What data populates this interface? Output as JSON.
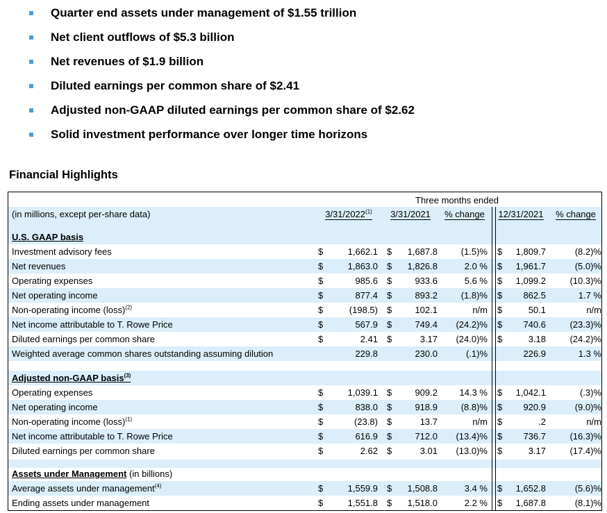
{
  "bullets": [
    "Quarter end assets under management of $1.55 trillion",
    "Net client outflows of $5.3 billion",
    "Net revenues of $1.9 billion",
    "Diluted earnings per common share of $2.41",
    "Adjusted non-GAAP diluted earnings per common share of $2.62",
    "Solid investment performance over longer time horizons"
  ],
  "heading": "Financial Highlights",
  "table": {
    "group_header": "Three months ended",
    "units_label": "(in millions, except per-share data)",
    "columns": {
      "c1": "3/31/2022",
      "c1_note": "(1)",
      "c2": "3/31/2021",
      "c3": "% change",
      "c4": "12/31/2021",
      "c5": "% change"
    },
    "sections": {
      "gaap": "U.S. GAAP basis",
      "nongaap": "Adjusted non-GAAP basis",
      "nongaap_note": "(3)",
      "aum": "Assets under Management",
      "aum_suffix": " (in billions)"
    },
    "dollar": "$",
    "rows": [
      {
        "label": "Investment advisory fees",
        "note": "",
        "d1": "$",
        "v1": "1,662.1",
        "d2": "$",
        "v2": "1,687.8",
        "p1": "(1.5)%",
        "d4": "$",
        "v4": "1,809.7",
        "p2": "(8.2)%"
      },
      {
        "label": "Net revenues",
        "note": "",
        "d1": "$",
        "v1": "1,863.0",
        "d2": "$",
        "v2": "1,826.8",
        "p1": "2.0 %",
        "d4": "$",
        "v4": "1,961.7",
        "p2": "(5.0)%"
      },
      {
        "label": "Operating expenses",
        "note": "",
        "d1": "$",
        "v1": "985.6",
        "d2": "$",
        "v2": "933.6",
        "p1": "5.6 %",
        "d4": "$",
        "v4": "1,099.2",
        "p2": "(10.3)%"
      },
      {
        "label": "Net operating income",
        "note": "",
        "d1": "$",
        "v1": "877.4",
        "d2": "$",
        "v2": "893.2",
        "p1": "(1.8)%",
        "d4": "$",
        "v4": "862.5",
        "p2": "1.7 %"
      },
      {
        "label": "Non-operating income (loss)",
        "note": "(2)",
        "d1": "$",
        "v1": "(198.5)",
        "d2": "$",
        "v2": "102.1",
        "p1": "n/m",
        "d4": "$",
        "v4": "50.1",
        "p2": "n/m"
      },
      {
        "label": "Net income attributable to T. Rowe Price",
        "note": "",
        "d1": "$",
        "v1": "567.9",
        "d2": "$",
        "v2": "749.4",
        "p1": "(24.2)%",
        "d4": "$",
        "v4": "740.6",
        "p2": "(23.3)%"
      },
      {
        "label": "Diluted earnings per common share",
        "note": "",
        "d1": "$",
        "v1": "2.41",
        "d2": "$",
        "v2": "3.17",
        "p1": "(24.0)%",
        "d4": "$",
        "v4": "3.18",
        "p2": "(24.2)%"
      },
      {
        "label": "Weighted average common shares outstanding assuming dilution",
        "note": "",
        "d1": "",
        "v1": "229.8",
        "d2": "",
        "v2": "230.0",
        "p1": "(.1)%",
        "d4": "",
        "v4": "226.9",
        "p2": "1.3 %"
      }
    ],
    "rows2": [
      {
        "label": "Operating expenses",
        "note": "",
        "d1": "$",
        "v1": "1,039.1",
        "d2": "$",
        "v2": "909.2",
        "p1": "14.3 %",
        "d4": "$",
        "v4": "1,042.1",
        "p2": "(.3)%"
      },
      {
        "label": "Net operating income",
        "note": "",
        "d1": "$",
        "v1": "838.0",
        "d2": "$",
        "v2": "918.9",
        "p1": "(8.8)%",
        "d4": "$",
        "v4": "920.9",
        "p2": "(9.0)%"
      },
      {
        "label": "Non-operating income (loss)",
        "note": "(1)",
        "d1": "$",
        "v1": "(23.8)",
        "d2": "$",
        "v2": "13.7",
        "p1": "n/m",
        "d4": "$",
        "v4": ".2",
        "p2": "n/m"
      },
      {
        "label": "Net income attributable to T. Rowe Price",
        "note": "",
        "d1": "$",
        "v1": "616.9",
        "d2": "$",
        "v2": "712.0",
        "p1": "(13.4)%",
        "d4": "$",
        "v4": "736.7",
        "p2": "(16.3)%"
      },
      {
        "label": "Diluted earnings per common share",
        "note": "",
        "d1": "$",
        "v1": "2.62",
        "d2": "$",
        "v2": "3.01",
        "p1": "(13.0)%",
        "d4": "$",
        "v4": "3.17",
        "p2": "(17.4)%"
      }
    ],
    "rows3": [
      {
        "label": "Average assets under management",
        "note": "(4)",
        "d1": "$",
        "v1": "1,559.9",
        "d2": "$",
        "v2": "1,508.8",
        "p1": "3.4 %",
        "d4": "$",
        "v4": "1,652.8",
        "p2": "(5.6)%"
      },
      {
        "label": "Ending assets under management",
        "note": "",
        "d1": "$",
        "v1": "1,551.8",
        "d2": "$",
        "v2": "1,518.0",
        "p1": "2.2 %",
        "d4": "$",
        "v4": "1,687.8",
        "p2": "(8.1)%"
      }
    ]
  }
}
